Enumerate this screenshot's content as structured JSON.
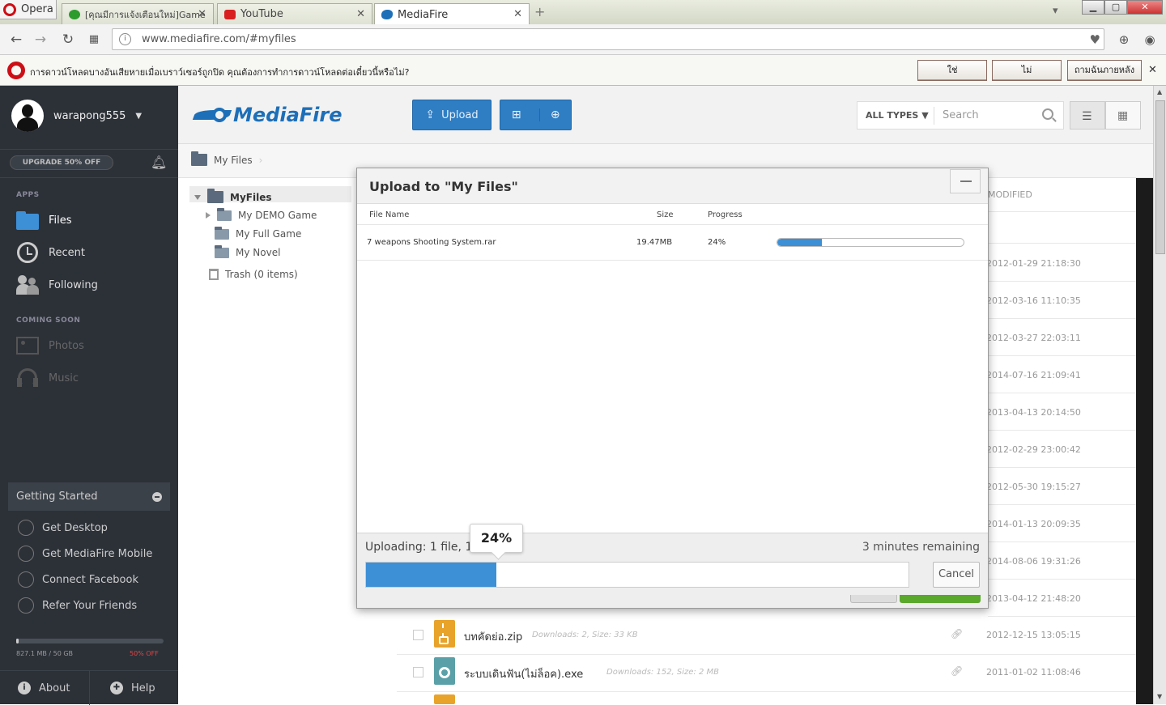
{
  "browser": {
    "opera_label": "Opera",
    "tabs": [
      {
        "label": "[คุณมีการแจ้งเตือนใหม่]Game",
        "close": "✕"
      },
      {
        "label": "YouTube",
        "close": "✕"
      },
      {
        "label": "MediaFire",
        "close": "✕"
      }
    ],
    "new_tab": "+",
    "url": "www.mediafire.com/#myfiles",
    "download_prompt": {
      "message": "การดาวน์โหลดบางอันเสียหายเมื่อเบราว์เซอร์ถูกปิด คุณต้องการทำการดาวน์โหลดต่อเดี๋ยวนี้หรือไม่?",
      "yes": "ใช่",
      "no": "ไม่",
      "later": "ถามฉันภายหลัง",
      "close": "✕"
    }
  },
  "sidebar": {
    "username": "warapong555",
    "upgrade": "UPGRADE 50% OFF",
    "apps_label": "APPS",
    "apps": [
      {
        "label": "Files"
      },
      {
        "label": "Recent"
      },
      {
        "label": "Following"
      }
    ],
    "coming_soon_label": "COMING SOON",
    "coming_soon": [
      {
        "label": "Photos"
      },
      {
        "label": "Music"
      }
    ],
    "getting_started": {
      "title": "Getting Started",
      "items": [
        "Get Desktop",
        "Get MediaFire Mobile",
        "Connect Facebook",
        "Refer Your Friends"
      ]
    },
    "storage": {
      "used": "827.1 MB / 50 GB",
      "offer": "50% OFF",
      "fraction": 0.016
    },
    "footer": {
      "about": "About",
      "help": "Help"
    }
  },
  "header": {
    "logo": "MediaFire",
    "upload": "Upload",
    "types": "ALL TYPES",
    "search_placeholder": "Search"
  },
  "breadcrumb": "My Files",
  "tree": {
    "root": "MyFiles",
    "folders": [
      "My DEMO Game",
      "My Full Game",
      "My Novel"
    ],
    "trash": "Trash (0 items)"
  },
  "list": {
    "modified_header": "MODIFIED",
    "dates": [
      "2012-01-29 21:18:30",
      "2012-03-16 11:10:35",
      "2012-03-27 22:03:11",
      "2014-07-16 21:09:41",
      "2013-04-13 20:14:50",
      "2012-02-29 23:00:42",
      "2012-05-30 19:15:27",
      "2014-01-13 20:09:35",
      "2014-08-06 19:31:26",
      "2013-04-12 21:48:20"
    ],
    "files": [
      {
        "name": "บทคัดย่อ.zip",
        "meta": "Downloads: 2, Size: 33 KB",
        "date": "2012-12-15 13:05:15"
      },
      {
        "name": "ระบบเดินฟัน(ไม่ล็อค).exe",
        "meta": "Downloads: 152, Size: 2 MB",
        "date": "2011-01-02 11:08:46"
      }
    ]
  },
  "modal": {
    "title": "Upload to \"My Files\"",
    "col_name": "File Name",
    "col_size": "Size",
    "col_progress": "Progress",
    "file": {
      "name": "7 weapons Shooting System.rar",
      "size": "19.47MB",
      "progress_text": "24%",
      "progress": 0.24
    },
    "footer_status": "Uploading: 1 file, 19",
    "tooltip": "24%",
    "remaining": "3 minutes remaining",
    "cancel": "Cancel"
  },
  "colors": {
    "accent": "#2f7ec4",
    "sidebar_bg": "#2c3138",
    "progress": "#3d8fd6",
    "opera_red": "#cc0f16"
  }
}
